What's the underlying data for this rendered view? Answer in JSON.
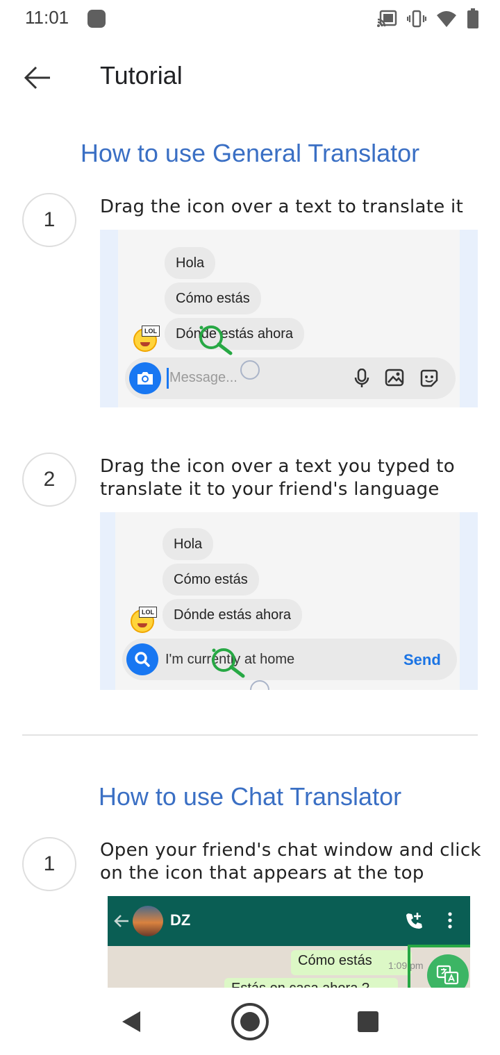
{
  "status_bar": {
    "time": "11:01",
    "icons": [
      "notification-dot-icon",
      "cast-icon",
      "vibrate-icon",
      "wifi-icon",
      "battery-icon"
    ]
  },
  "app_bar": {
    "back_icon": "arrow-back-icon",
    "title": "Tutorial"
  },
  "general_section": {
    "title": "How to use General Translator",
    "steps": [
      {
        "number": "1",
        "text": "Drag the icon over a text to translate it",
        "preview": {
          "bubbles": [
            "Hola",
            "Cómo estás",
            "Dónde estás ahora"
          ],
          "sticker_label": "LOL",
          "compose_placeholder": "Message...",
          "compose_icons": [
            "camera-icon",
            "microphone-icon",
            "image-icon",
            "sticker-icon"
          ]
        }
      },
      {
        "number": "2",
        "text": "Drag the icon over a text you typed to translate it to your friend's language",
        "preview": {
          "bubbles": [
            "Hola",
            "Cómo estás",
            "Dónde estás ahora"
          ],
          "sticker_label": "LOL",
          "compose_text": "I'm currently at home",
          "send_label": "Send",
          "compose_icons": [
            "search-icon"
          ]
        }
      }
    ]
  },
  "chat_section": {
    "title": "How to use Chat Translator",
    "steps": [
      {
        "number": "1",
        "text": "Open your friend's chat window and click on the icon that appears at the top",
        "preview": {
          "contact_name": "DZ",
          "messages": [
            {
              "text": "Cómo estás",
              "time": "1:09 pm"
            },
            {
              "text": "Estás en casa ahora ?",
              "time": ""
            }
          ],
          "icons": [
            "arrow-back-icon",
            "add-call-icon",
            "more-vert-icon",
            "translate-icon"
          ]
        }
      }
    ]
  },
  "nav_bar": {
    "icons": [
      "nav-back-icon",
      "nav-home-icon",
      "nav-recents-icon"
    ]
  },
  "colors": {
    "accent": "#3a6fc4",
    "messenger_blue": "#1877f2",
    "whatsapp_green": "#0a5e54",
    "magnifier_green": "#27a844"
  }
}
